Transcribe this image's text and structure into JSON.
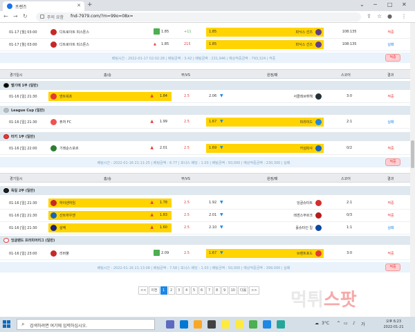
{
  "browser": {
    "tab_title": "프렌즈",
    "new_tab": "+",
    "security_warning": "주의 요함",
    "url": "fnd-7979.com/?m=99o=08x=",
    "win_min": "⌄",
    "win_restore": "─",
    "win_max": "□",
    "win_close": "✕"
  },
  "top_rows": [
    {
      "date": "01-17 [월] 03:00",
      "home": "디트로이트 피스톤스",
      "home_odd": "1.85",
      "line": "+11",
      "away_odd": "1.85",
      "away": "피닉스 선즈",
      "score": "108:135",
      "result": "적중",
      "result_type": "hit"
    },
    {
      "date": "01-17 [월] 03:00",
      "home": "디트로이트 피스톤스",
      "home_odd": "1.85",
      "line": "215",
      "away_odd": "1.85",
      "away": "피닉스 선즈",
      "score": "108:135",
      "result": "실패",
      "result_type": "miss"
    }
  ],
  "summary1": {
    "text": "배팅시간 : 2022-01-17 02:02:28  |  배팅금액 : 3.42  |  배팅금액 : 231,946  |  예상적중금액 : 793,324  |  적중",
    "button": "적중"
  },
  "header1": {
    "date": "경기일시",
    "home": "홈/승",
    "draw": "무/VS",
    "away": "원정/패",
    "score": "스코어",
    "result": "결과"
  },
  "league_a": "벨기에 1부 (일반)",
  "row_a": {
    "date": "01-16 [일] 21:30",
    "home": "앤트워프",
    "home_odd": "1.84",
    "draw": "2.5",
    "away_odd": "2.06",
    "away": "서클레브뤼헤",
    "score": "3:0",
    "result": "적중",
    "result_type": "hit"
  },
  "league_b": "League Cup (일반)",
  "row_b": {
    "date": "01-16 [일] 21:30",
    "home": "퓨처 FC",
    "home_odd": "1.99",
    "draw": "2.5",
    "away_odd": "1.67",
    "away": "피라미드",
    "score": "2:1",
    "result": "실패",
    "result_type": "miss"
  },
  "league_c": "터키 1부 (일반)",
  "row_c": {
    "date": "01-16 [일] 22:00",
    "home": "기레순스포르",
    "home_odd": "2.01",
    "draw": "2.5",
    "away_odd": "1.69",
    "away": "카심파샤",
    "score": "0/2",
    "result": "적중",
    "result_type": "hit"
  },
  "summary2": {
    "text": "배팅시간 : 2022-01-16 21:11:25  |  배팅금액 : 6.77  |  보너스 배당 : 1.03  |  배팅금액 : 50,000  |  예상적중금액 : 230,300  |  실패",
    "button": "적중"
  },
  "league_d": "독일 2부 (일반)",
  "header2": {
    "date": "경기일시",
    "home": "홈/승",
    "draw": "무/VS",
    "away": "원정/패",
    "score": "스코어",
    "result": "결과"
  },
  "rows_d": [
    {
      "date": "01-16 [일] 21:30",
      "home": "하이덴하임",
      "home_odd": "1.78",
      "draw": "2.5",
      "away_odd": "1.92",
      "away": "잉골슈타트",
      "score": "2:1",
      "result": "적중",
      "result_type": "hit"
    },
    {
      "date": "01-16 [일] 21:30",
      "home": "산트하우젠",
      "home_odd": "1.83",
      "draw": "2.5",
      "away_odd": "2.01",
      "away": "레겐스부르크",
      "score": "0/3",
      "result": "적중",
      "result_type": "hit"
    },
    {
      "date": "01-16 [일] 21:30",
      "home": "샬케",
      "home_odd": "1.60",
      "draw": "2.5",
      "away_odd": "2.10",
      "away": "홀슈타인 킬",
      "score": "1:1",
      "result": "실패",
      "result_type": "miss"
    }
  ],
  "league_e": "잉글랜드 프리미어리그 (일반)",
  "row_e": {
    "date": "01-16 [일] 23:00",
    "home": "리버풀",
    "home_odd": "2.09",
    "draw": "2.5",
    "away_odd": "1.67",
    "away": "브렌트포드",
    "score": "3:0",
    "result": "적중",
    "result_type": "hit"
  },
  "summary3": {
    "text": "배팅시간 : 2022-01-16 21:13:08  |  배팅금액 : 7.58  |  보너스 배당 : 1.03  |  배팅금액 : 50,000  |  예상적중금액 : 399,000  |  실패",
    "button": "적중"
  },
  "pagination": [
    "<<",
    "이전",
    "1",
    "2",
    "3",
    "4",
    "5",
    "6",
    "7",
    "8",
    "9",
    "10",
    "다음",
    ">>"
  ],
  "watermark": {
    "a": "먹튀",
    "b": "스팟"
  },
  "taskbar": {
    "search_placeholder": "검색하려면 여기에 입력하십시오.",
    "weather": "3°C",
    "ime": "가",
    "time": "오후 6:23",
    "date": "2022-01-21"
  }
}
